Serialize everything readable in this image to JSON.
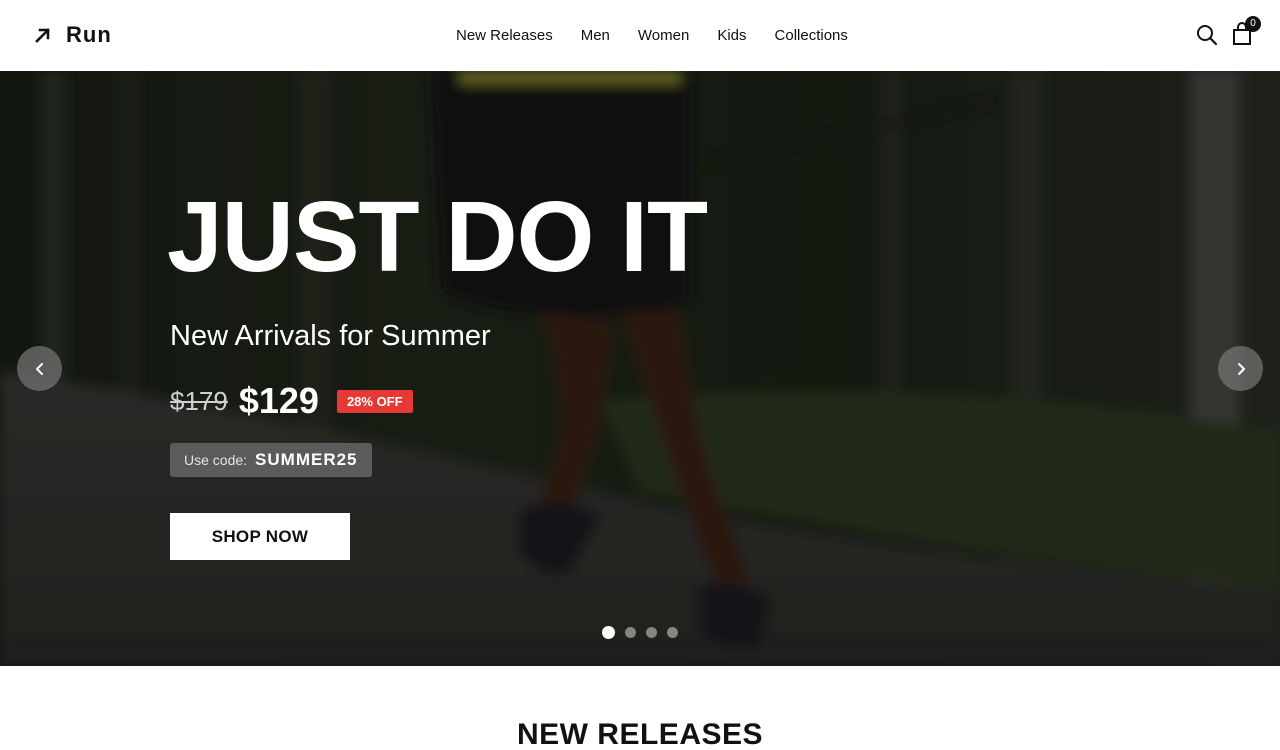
{
  "brand": {
    "name": "Run",
    "logo_icon": "arrow-up-right-icon"
  },
  "nav": {
    "items": [
      "New Releases",
      "Men",
      "Women",
      "Kids",
      "Collections"
    ]
  },
  "header_icons": {
    "search_icon": "search-icon",
    "cart_icon": "shopping-bag-icon",
    "cart_count": "0"
  },
  "hero": {
    "title": "JUST DO IT",
    "subtitle": "New Arrivals for Summer",
    "price_old": "$179",
    "price_new": "$129",
    "discount": "28% OFF",
    "code_label": "Use code:",
    "code_value": "SUMMER25",
    "cta": "SHOP NOW",
    "slide_count": 4,
    "active_slide": 1,
    "prev_icon": "chevron-left-icon",
    "next_icon": "chevron-right-icon"
  },
  "section": {
    "title": "NEW RELEASES"
  },
  "colors": {
    "accent": "#e53935",
    "dark": "#111111",
    "hero_bg": "#1e2319"
  }
}
